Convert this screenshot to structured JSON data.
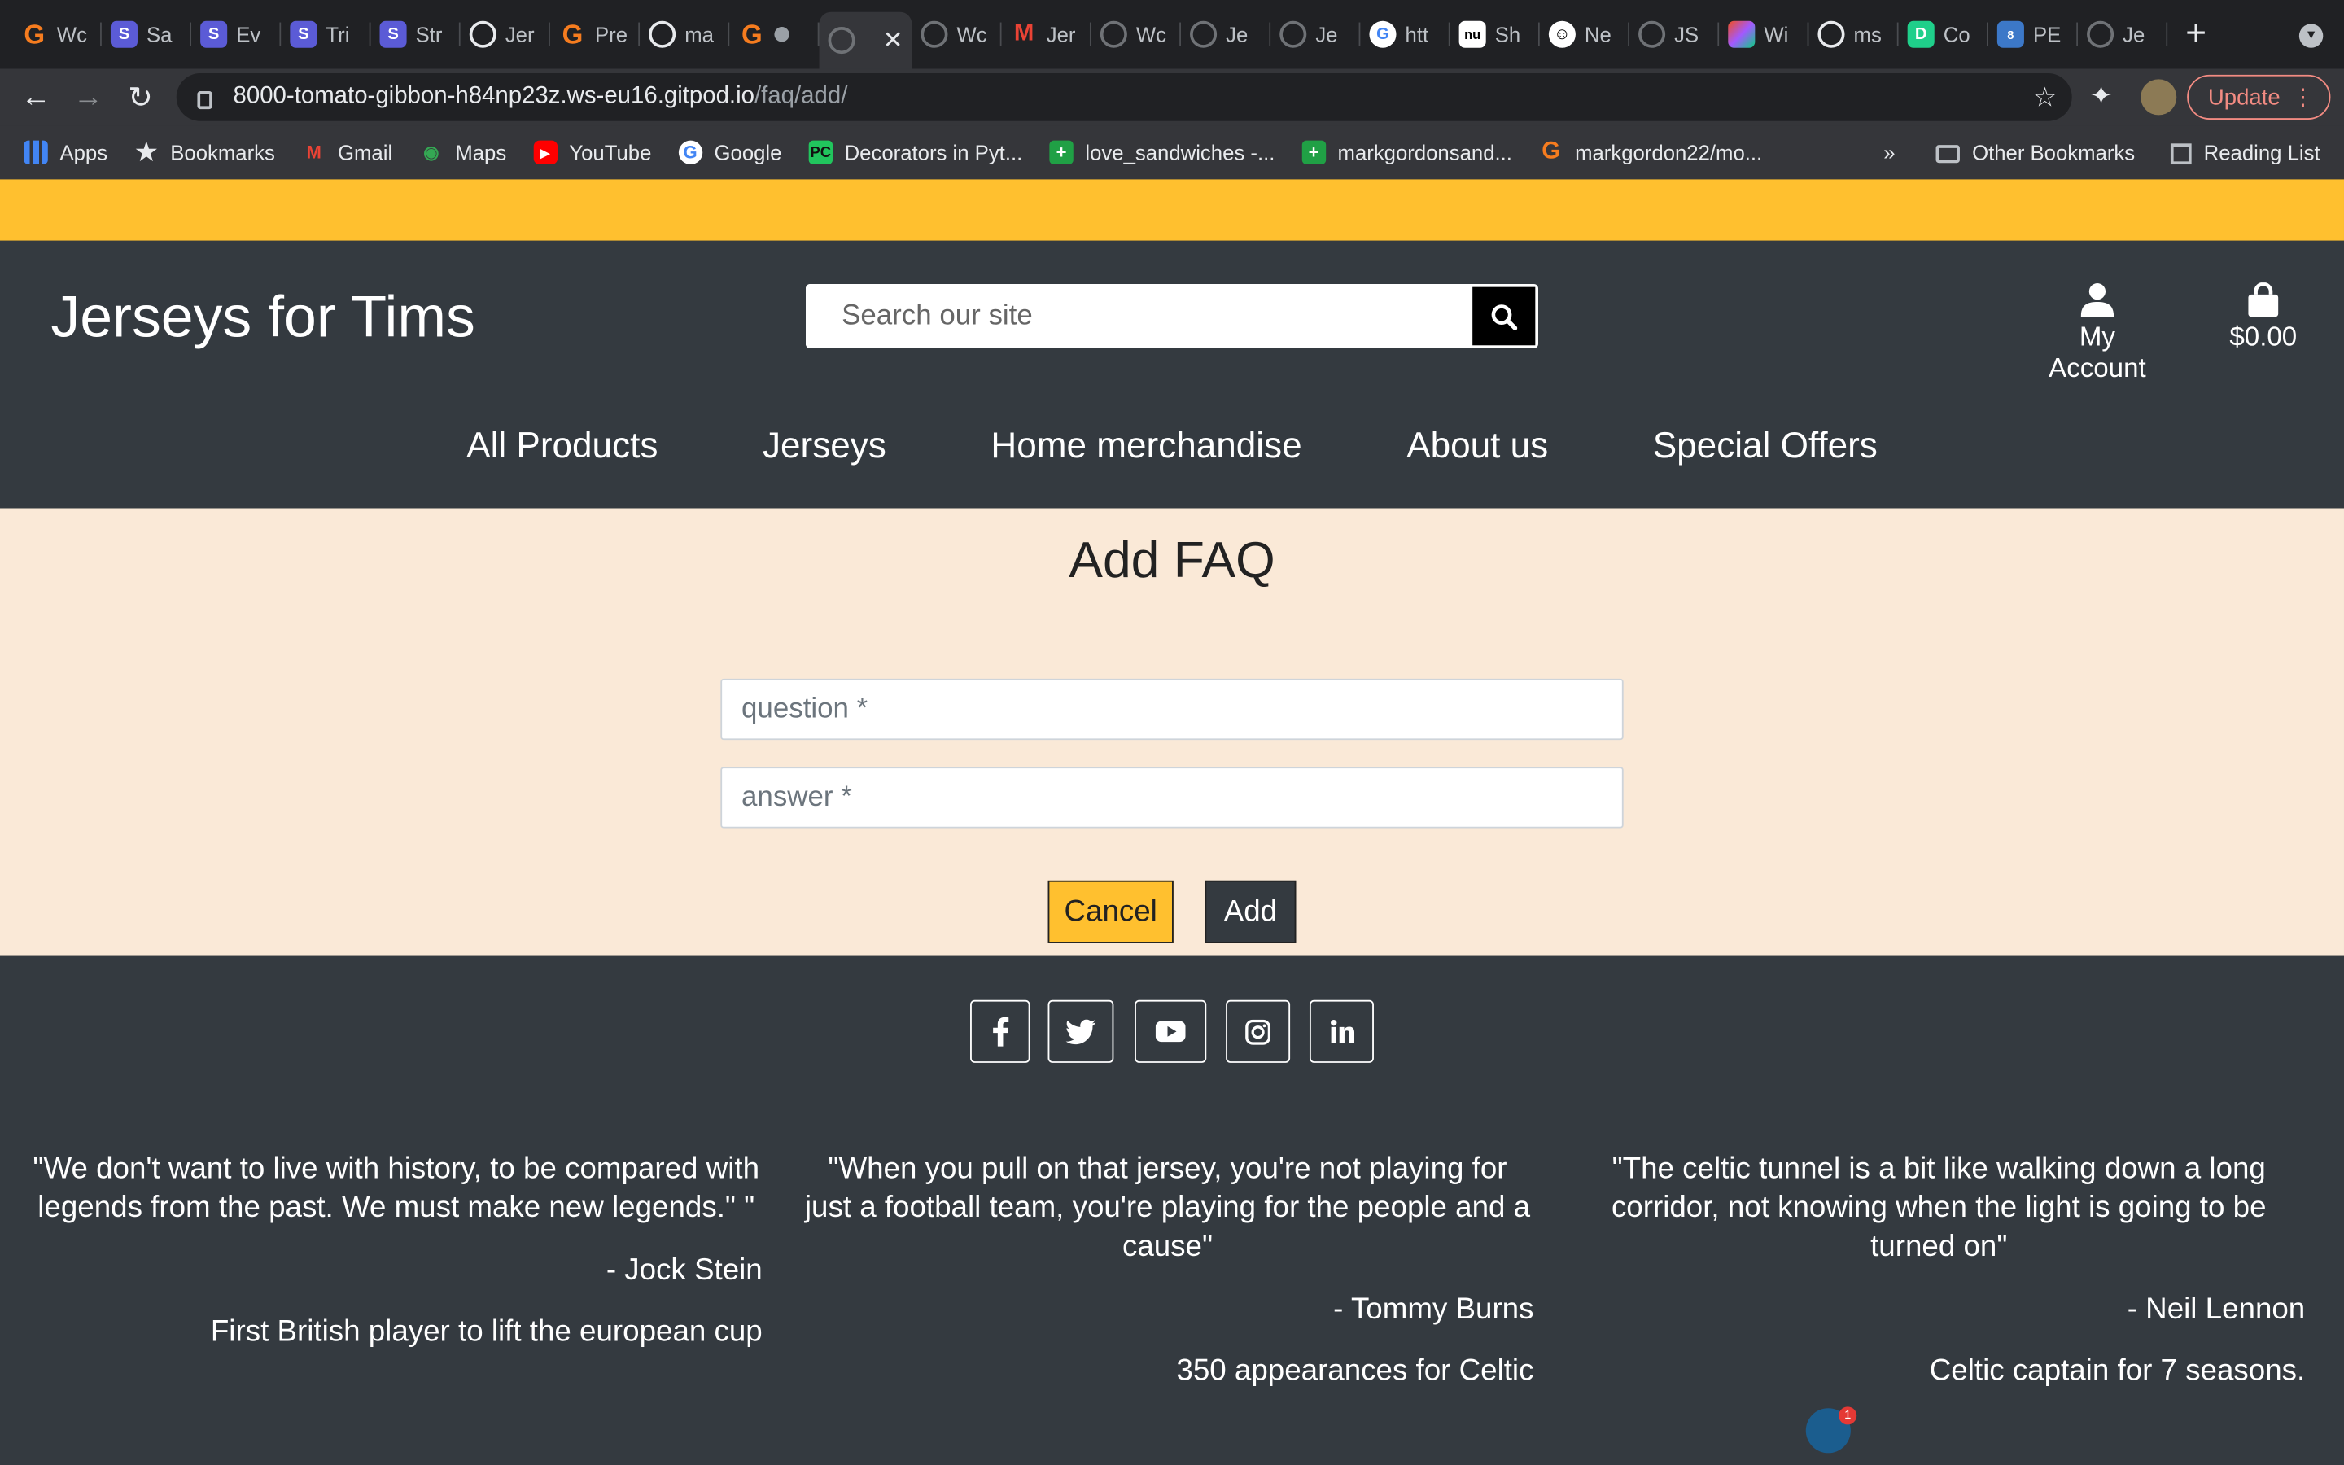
{
  "browser": {
    "tabs": [
      {
        "label": "Wc",
        "icon": "gitpod-icon"
      },
      {
        "label": "Sa",
        "icon": "s-icon"
      },
      {
        "label": "Ev",
        "icon": "s-icon"
      },
      {
        "label": "Tri",
        "icon": "s-icon"
      },
      {
        "label": "Str",
        "icon": "s-icon"
      },
      {
        "label": "Jer",
        "icon": "github-icon"
      },
      {
        "label": "Pre",
        "icon": "gitpod-icon"
      },
      {
        "label": "ma",
        "icon": "github-icon"
      }
    ],
    "tabs_after": [
      {
        "label": "Wc",
        "icon": "globe-icon"
      },
      {
        "label": "Jer",
        "icon": "gmail-icon"
      },
      {
        "label": "Wc",
        "icon": "globe-icon"
      },
      {
        "label": "Je",
        "icon": "globe-icon"
      },
      {
        "label": "Je",
        "icon": "globe-icon"
      },
      {
        "label": "htt",
        "icon": "google-icon"
      },
      {
        "label": "Sh",
        "icon": "nu-icon"
      },
      {
        "label": "Ne",
        "icon": "smiley-icon"
      },
      {
        "label": "JS",
        "icon": "globe-icon"
      },
      {
        "label": "Wi",
        "icon": "figma-icon"
      },
      {
        "label": "ms",
        "icon": "github-icon"
      },
      {
        "label": "Co",
        "icon": "d-icon"
      },
      {
        "label": "PE",
        "icon": "pep8-icon"
      },
      {
        "label": "Je",
        "icon": "globe-icon"
      }
    ],
    "url_host": "8000-tomato-gibbon-h84np23z.ws-eu16.gitpod.io",
    "url_path": "/faq/add/",
    "update_label": "Update",
    "bookmarks": [
      {
        "label": "Apps",
        "icon": "apps-icon"
      },
      {
        "label": "Bookmarks",
        "icon": "star-icon"
      },
      {
        "label": "Gmail",
        "icon": "gmail-icon"
      },
      {
        "label": "Maps",
        "icon": "maps-icon"
      },
      {
        "label": "YouTube",
        "icon": "youtube-icon"
      },
      {
        "label": "Google",
        "icon": "google-icon"
      },
      {
        "label": "Decorators in Pyt...",
        "icon": "pycharm-icon"
      },
      {
        "label": "love_sandwiches -...",
        "icon": "sheets-icon"
      },
      {
        "label": "markgordonsand...",
        "icon": "sheets-icon"
      },
      {
        "label": "markgordon22/mo...",
        "icon": "gitpod-icon"
      }
    ],
    "bookmarks_more": "»",
    "other_bookmarks": "Other Bookmarks",
    "reading_list": "Reading List"
  },
  "site": {
    "brand": "Jerseys for Tims",
    "search_placeholder": "Search our site",
    "account_label": "My Account",
    "cart_total": "$0.00",
    "nav": [
      "All Products",
      "Jerseys",
      "Home merchandise",
      "About us",
      "Special Offers"
    ],
    "colors": {
      "banner": "#ffc02f",
      "header": "#343a40",
      "content_bg": "#fae9d7"
    }
  },
  "form": {
    "title": "Add FAQ",
    "question_placeholder": "question *",
    "answer_placeholder": "answer *",
    "cancel_label": "Cancel",
    "add_label": "Add"
  },
  "footer": {
    "social": [
      "facebook-icon",
      "twitter-icon",
      "youtube-icon",
      "instagram-icon",
      "linkedin-icon"
    ],
    "quotes": [
      {
        "text": "\"We don't want to live with history, to be compared with legends from the past. We must make new legends.\"  \"",
        "dash": "- ",
        "author": "Jock Stein",
        "note": "First British player to lift the european cup"
      },
      {
        "text": "\"When you pull on that jersey, you're not playing for just a football team, you're playing for the people and a cause\"",
        "dash": "- ",
        "author": "Tommy Burns",
        "note": "350 appearances for Celtic"
      },
      {
        "text": "\"The celtic tunnel is a bit like walking down a long corridor, not knowing when the light is going to be turned on\"",
        "dash": "- ",
        "author": "Neil Lennon",
        "note": "Celtic captain for 7 seasons."
      }
    ],
    "notification_count": "1"
  }
}
